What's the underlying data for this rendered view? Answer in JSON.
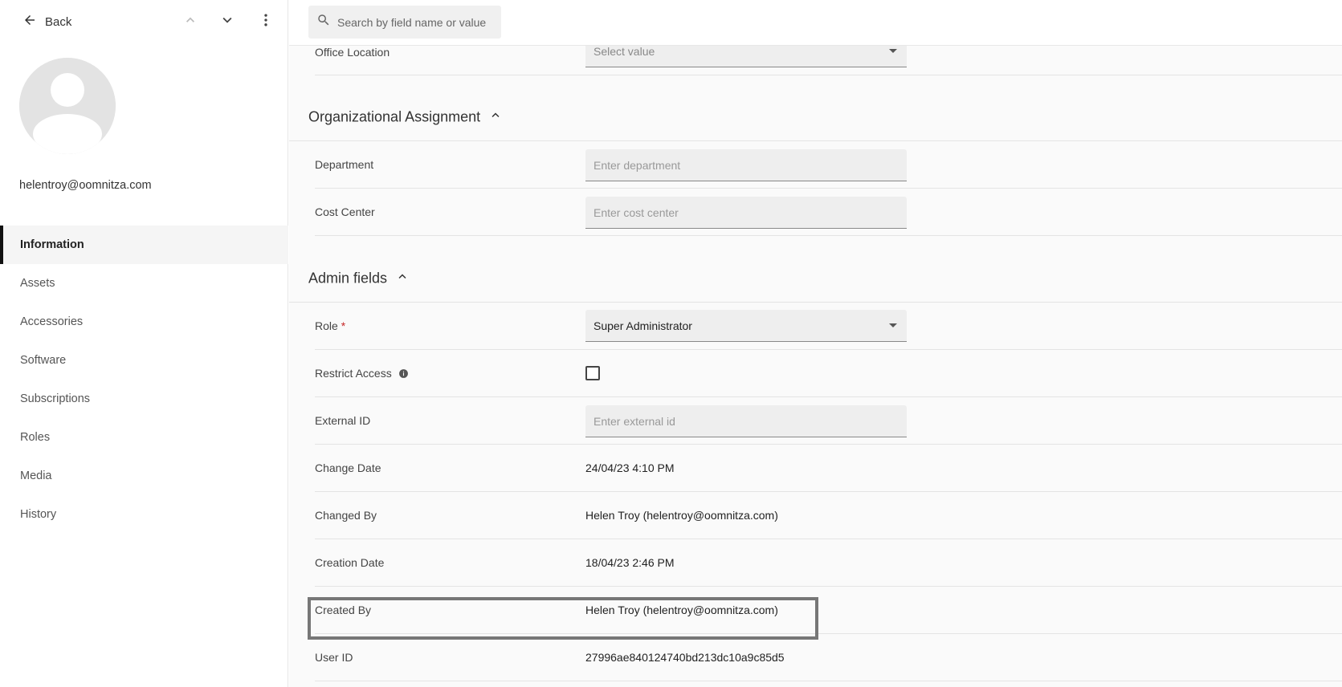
{
  "sidebar": {
    "back_label": "Back",
    "email": "helentroy@oomnitza.com",
    "nav": [
      {
        "label": "Information",
        "active": true
      },
      {
        "label": "Assets"
      },
      {
        "label": "Accessories"
      },
      {
        "label": "Software"
      },
      {
        "label": "Subscriptions"
      },
      {
        "label": "Roles"
      },
      {
        "label": "Media"
      },
      {
        "label": "History"
      }
    ]
  },
  "search": {
    "placeholder": "Search by field name or value"
  },
  "fields": {
    "office_location": {
      "label": "Office Location",
      "placeholder": "Select value"
    }
  },
  "org_section": {
    "title": "Organizational Assignment",
    "department": {
      "label": "Department",
      "placeholder": "Enter department"
    },
    "cost_center": {
      "label": "Cost Center",
      "placeholder": "Enter cost center"
    }
  },
  "admin_section": {
    "title": "Admin fields",
    "role": {
      "label": "Role",
      "required_mark": "*",
      "value": "Super Administrator"
    },
    "restrict_access": {
      "label": "Restrict Access",
      "checked": false
    },
    "external_id": {
      "label": "External ID",
      "placeholder": "Enter external id"
    },
    "change_date": {
      "label": "Change Date",
      "value": "24/04/23 4:10 PM"
    },
    "changed_by": {
      "label": "Changed By",
      "value": "Helen Troy (helentroy@oomnitza.com)"
    },
    "creation_date": {
      "label": "Creation Date",
      "value": "18/04/23 2:46 PM"
    },
    "created_by": {
      "label": "Created By",
      "value": "Helen Troy (helentroy@oomnitza.com)"
    },
    "user_id": {
      "label": "User ID",
      "value": "27996ae840124740bd213dc10a9c85d5"
    }
  },
  "colors": {
    "accent": "#111111",
    "required": "#c62828",
    "highlight_border": "#777777"
  }
}
